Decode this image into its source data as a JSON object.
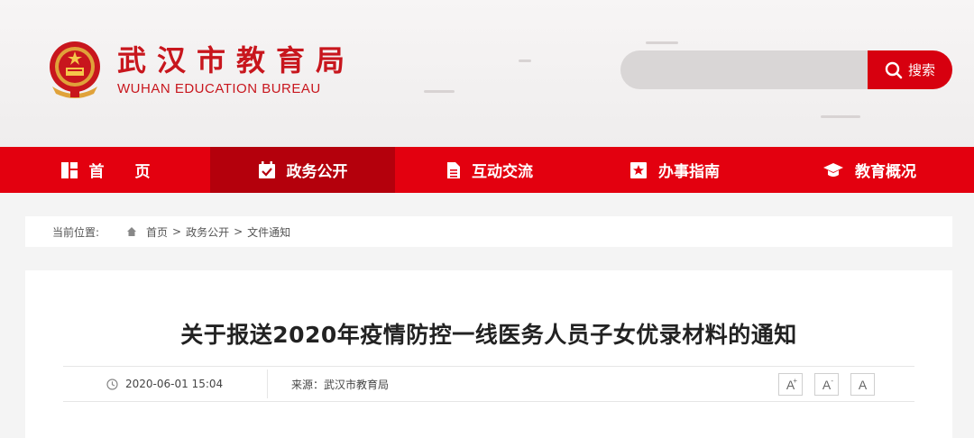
{
  "header": {
    "site_title": "武汉市教育局",
    "site_subtitle": "WUHAN EDUCATION BUREAU",
    "search_placeholder": "",
    "search_button_label": "搜索"
  },
  "nav": {
    "items": [
      {
        "label": "首　　页",
        "icon": "home-grid-icon",
        "active": false
      },
      {
        "label": "政务公开",
        "icon": "calendar-check-icon",
        "active": true
      },
      {
        "label": "互动交流",
        "icon": "document-icon",
        "active": false
      },
      {
        "label": "办事指南",
        "icon": "bookmark-star-icon",
        "active": false
      },
      {
        "label": "教育概况",
        "icon": "graduation-cap-icon",
        "active": false
      }
    ]
  },
  "breadcrumb": {
    "label": "当前位置:",
    "items": [
      "首页",
      "政务公开",
      "文件通知"
    ],
    "separator": ">"
  },
  "article": {
    "title": "关于报送2020年疫情防控一线医务人员子女优录材料的通知",
    "date": "2020-06-01 15:04",
    "source": "来源：武汉市教育局",
    "font_size_buttons": [
      "A",
      "A",
      "A"
    ],
    "font_size_marks": [
      "+",
      "-",
      ""
    ]
  },
  "colors": {
    "brand_red": "#e3000f",
    "nav_active": "#b4000c",
    "title_red": "#c8161d"
  }
}
